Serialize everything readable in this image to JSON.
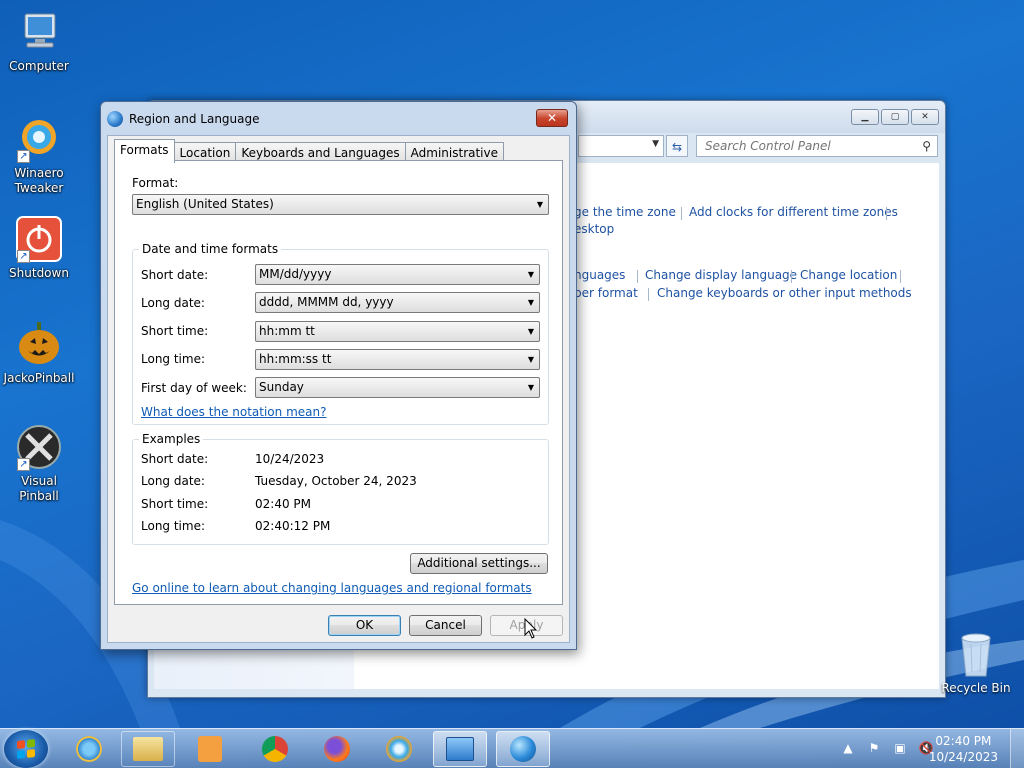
{
  "desktop": {
    "icons": [
      {
        "label": "Computer"
      },
      {
        "label": "Winaero Tweaker"
      },
      {
        "label": "Shutdown"
      },
      {
        "label": "JackoPinball"
      },
      {
        "label": "Visual Pinball"
      }
    ],
    "recycle_bin": "Recycle Bin"
  },
  "control_panel": {
    "search_placeholder": "Search Control Panel",
    "links": [
      "ge the time zone",
      "Add clocks for different time zones",
      "esktop",
      "nguages",
      "Change display language",
      "Change location",
      "ber format",
      "Change keyboards or other input methods"
    ]
  },
  "dialog": {
    "title": "Region and Language",
    "tabs": [
      "Formats",
      "Location",
      "Keyboards and Languages",
      "Administrative"
    ],
    "format_label": "Format:",
    "format_value": "English (United States)",
    "date_time_group": "Date and time formats",
    "fields": [
      {
        "label": "Short date:",
        "value": "MM/dd/yyyy"
      },
      {
        "label": "Long date:",
        "value": "dddd, MMMM dd, yyyy"
      },
      {
        "label": "Short time:",
        "value": "hh:mm tt"
      },
      {
        "label": "Long time:",
        "value": "hh:mm:ss tt"
      },
      {
        "label": "First day of week:",
        "value": "Sunday"
      }
    ],
    "notation_link": "What does the notation mean?",
    "examples_group": "Examples",
    "examples": [
      {
        "label": "Short date:",
        "value": "10/24/2023"
      },
      {
        "label": "Long date:",
        "value": "Tuesday, October 24, 2023"
      },
      {
        "label": "Short time:",
        "value": "02:40 PM"
      },
      {
        "label": "Long time:",
        "value": "02:40:12 PM"
      }
    ],
    "additional_settings": "Additional settings...",
    "online_link": "Go online to learn about changing languages and regional formats",
    "ok": "OK",
    "cancel": "Cancel",
    "apply": "Apply"
  },
  "taskbar": {
    "time": "02:40 PM",
    "date": "10/24/2023"
  },
  "colors": {
    "accent_link": "#0f5bb5",
    "close_red": "#c8432a"
  }
}
